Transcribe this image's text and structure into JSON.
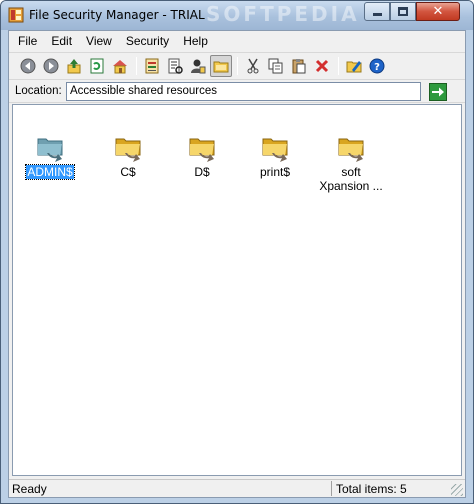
{
  "window": {
    "title": "File Security Manager - TRIAL",
    "watermark": "SOFTPEDIA"
  },
  "menu": [
    "File",
    "Edit",
    "View",
    "Security",
    "Help"
  ],
  "toolbar": {
    "buttons": [
      {
        "name": "back-icon"
      },
      {
        "name": "forward-icon"
      },
      {
        "name": "up-folder-icon"
      },
      {
        "name": "refresh-icon"
      },
      {
        "name": "home-icon"
      },
      {
        "name": "permissions-icon"
      },
      {
        "name": "audit-icon"
      },
      {
        "name": "user-icon"
      },
      {
        "name": "folder-view-icon",
        "active": true
      },
      {
        "name": "cut-icon"
      },
      {
        "name": "copy-icon"
      },
      {
        "name": "paste-icon"
      },
      {
        "name": "delete-icon"
      },
      {
        "name": "properties-icon"
      },
      {
        "name": "help-icon"
      }
    ]
  },
  "location": {
    "label": "Location:",
    "value": "Accessible shared resources"
  },
  "files": [
    {
      "label": "ADMIN$",
      "icon": "shared-folder-blue-icon",
      "selected": true
    },
    {
      "label": "C$",
      "icon": "shared-folder-icon",
      "selected": false
    },
    {
      "label": "D$",
      "icon": "shared-folder-icon",
      "selected": false
    },
    {
      "label": "print$",
      "icon": "shared-folder-icon",
      "selected": false
    },
    {
      "label": "soft Xpansion ...",
      "icon": "shared-folder-icon",
      "selected": false
    }
  ],
  "status": {
    "left": "Ready",
    "right": "Total items: 5"
  },
  "colors": {
    "selection": "#3399ff",
    "folder": "#f2c94c",
    "frame": "#bcd0e6"
  }
}
